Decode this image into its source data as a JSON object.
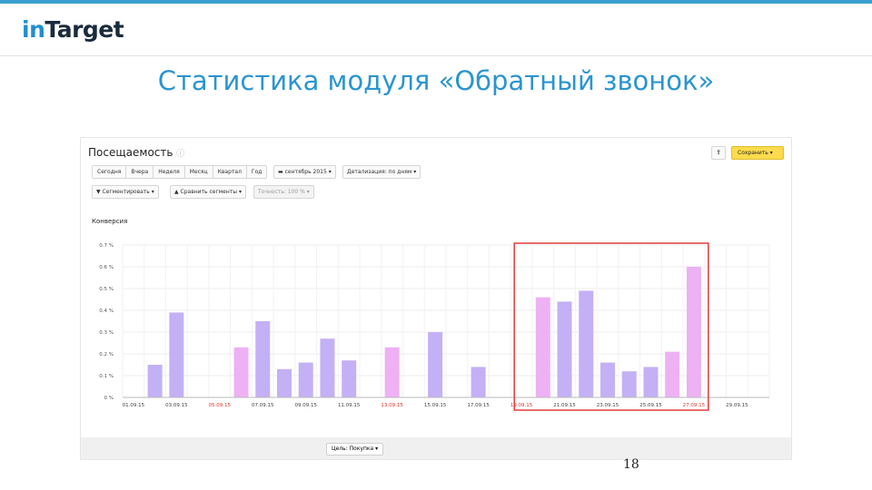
{
  "logo": {
    "part1": "in",
    "part2": "Target"
  },
  "slide": {
    "title": "Статистика модуля «Обратный звонок»",
    "page_number": "18"
  },
  "panel": {
    "title": "Посещаемость",
    "title_hint": "ⓘ",
    "period_buttons": [
      "Сегодня",
      "Вчера",
      "Неделя",
      "Месяц",
      "Квартал",
      "Год"
    ],
    "date_range": "сентябрь 2015",
    "detail_select": "Детализация: по дням",
    "segment_button": "Сегментировать",
    "compare_button": "Сравнить сегменты",
    "accuracy": "Точность: 100 %",
    "save_button": "Сохранить",
    "section_label": "Конверсия",
    "goal_select": "Цель: Покупка"
  },
  "colors": {
    "weekday_bar": "#c4b0f5",
    "weekend_bar": "#eeb1f4",
    "weekend_label": "#e0352b",
    "highlight": "#e33b3b",
    "title": "#2b95cf",
    "logo_blue": "#1f8fd0"
  },
  "chart_data": {
    "type": "bar",
    "title": "Конверсия",
    "ylabel": "",
    "xlabel": "",
    "ylim": [
      0,
      0.7
    ],
    "y_ticks": [
      "0 %",
      "0.1 %",
      "0.2 %",
      "0.3 %",
      "0.4 %",
      "0.5 %",
      "0.6 %",
      "0.7 %"
    ],
    "categories": [
      "01.09.15",
      "02.09.15",
      "03.09.15",
      "04.09.15",
      "05.09.15",
      "06.09.15",
      "07.09.15",
      "08.09.15",
      "09.09.15",
      "10.09.15",
      "11.09.15",
      "12.09.15",
      "13.09.15",
      "14.09.15",
      "15.09.15",
      "16.09.15",
      "17.09.15",
      "18.09.15",
      "19.09.15",
      "20.09.15",
      "21.09.15",
      "22.09.15",
      "23.09.15",
      "24.09.15",
      "25.09.15",
      "26.09.15",
      "27.09.15",
      "28.09.15",
      "29.09.15",
      "30.09.15"
    ],
    "values": [
      0,
      0.15,
      0.39,
      0,
      0,
      0.23,
      0.35,
      0.13,
      0.16,
      0.27,
      0.17,
      0,
      0.23,
      0,
      0.3,
      0,
      0.14,
      0,
      0,
      0.46,
      0.44,
      0.49,
      0.16,
      0.12,
      0.14,
      0.21,
      0.6,
      0,
      0,
      0
    ],
    "weekend": [
      false,
      false,
      false,
      false,
      true,
      true,
      false,
      false,
      false,
      false,
      false,
      true,
      true,
      false,
      false,
      false,
      false,
      false,
      true,
      true,
      false,
      false,
      false,
      false,
      false,
      true,
      true,
      false,
      false,
      false
    ],
    "x_tick_labels": [
      "01.09.15",
      "03.09.15",
      "05.09.15",
      "07.09.15",
      "09.09.15",
      "11.09.15",
      "13.09.15",
      "15.09.15",
      "17.09.15",
      "19.09.15",
      "21.09.15",
      "23.09.15",
      "25.09.15",
      "27.09.15",
      "29.09.15"
    ],
    "highlighted_range": [
      "19.09.15",
      "27.09.15"
    ]
  }
}
